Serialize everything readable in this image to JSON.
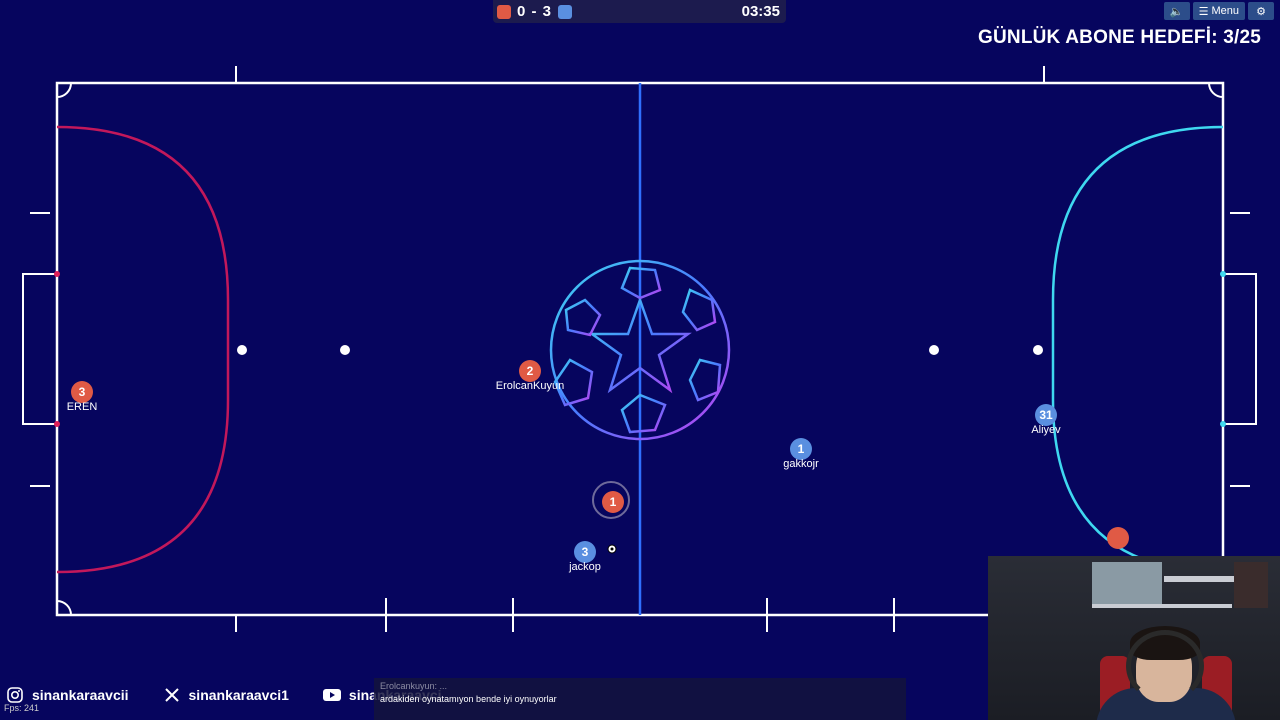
{
  "scoreboard": {
    "score": "0 - 3",
    "clock": "03:35",
    "red_color": "#e05a45",
    "blue_color": "#5a8fe0"
  },
  "top_buttons": {
    "sound_icon": "speaker-icon",
    "menu_label": "Menu",
    "settings_icon": "gear-icon"
  },
  "goal_text": "GÜNLÜK ABONE HEDEFİ: 3/25",
  "players": [
    {
      "number": "3",
      "name": "EREN",
      "team": "red"
    },
    {
      "number": "2",
      "name": "ErolcanKuyun",
      "team": "red"
    },
    {
      "number": "1",
      "name": "",
      "team": "red",
      "self": true
    },
    {
      "number": "3",
      "name": "jackop",
      "team": "blue"
    },
    {
      "number": "1",
      "name": "gakkojr",
      "team": "blue"
    },
    {
      "number": "31",
      "name": "Aliyev",
      "team": "blue"
    },
    {
      "number": "",
      "name": "",
      "team": "red"
    }
  ],
  "social": {
    "instagram": "sinankaraavcii",
    "x": "sinankaraavci1",
    "youtube": "sinankaraavci"
  },
  "fps": "Fps: 241",
  "chat": {
    "line1": "Erolcankuyun: ...",
    "line2": "ardakiden oynatamıyon bende iyi oynuyorlar"
  },
  "colors": {
    "background": "#06055e",
    "left_area": "#c2185b",
    "right_area": "#3fd8f0",
    "center_line": "#2f6fff"
  }
}
